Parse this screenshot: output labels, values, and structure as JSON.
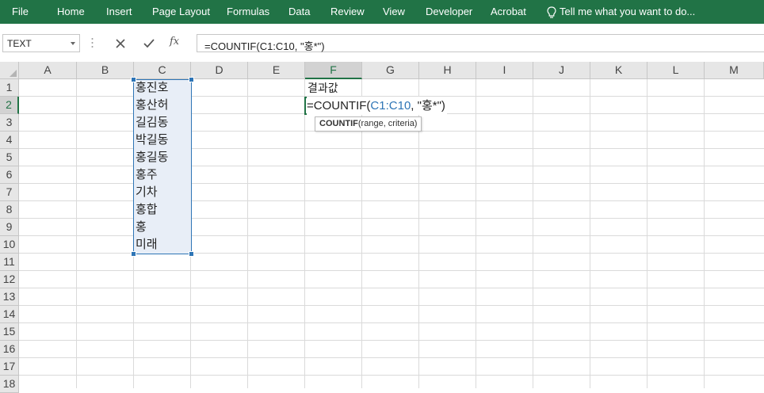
{
  "ribbon": {
    "tabs": [
      "File",
      "Home",
      "Insert",
      "Page Layout",
      "Formulas",
      "Data",
      "Review",
      "View",
      "Developer",
      "Acrobat"
    ],
    "tell_me": "Tell me what you want to do...",
    "brand_color": "#217346"
  },
  "formula_bar": {
    "name_box": "TEXT",
    "cancel_icon": "x-icon",
    "enter_icon": "check-icon",
    "fx_label": "fx",
    "formula": "=COUNTIF(C1:C10, \"홍*\")"
  },
  "columns": [
    "A",
    "B",
    "C",
    "D",
    "E",
    "F",
    "G",
    "H",
    "I",
    "J",
    "K",
    "L",
    "M"
  ],
  "rows": [
    "1",
    "2",
    "3",
    "4",
    "5",
    "6",
    "7",
    "8",
    "9",
    "10",
    "11",
    "12",
    "13",
    "14",
    "15",
    "16",
    "17",
    "18"
  ],
  "active_column": "F",
  "active_row": "2",
  "cells": {
    "C": [
      "홍진호",
      "홍산허",
      "길김동",
      "박길동",
      "홍길동",
      "홍주",
      "기차",
      "홍합",
      "홍",
      "미래"
    ],
    "F1": "결과값"
  },
  "edit": {
    "prefix": "=COUNTIF(",
    "ref": "C1:C10",
    "suffix": ", \"홍*\")"
  },
  "tooltip": {
    "fn": "COUNTIF",
    "args": "(range, criteria)"
  }
}
